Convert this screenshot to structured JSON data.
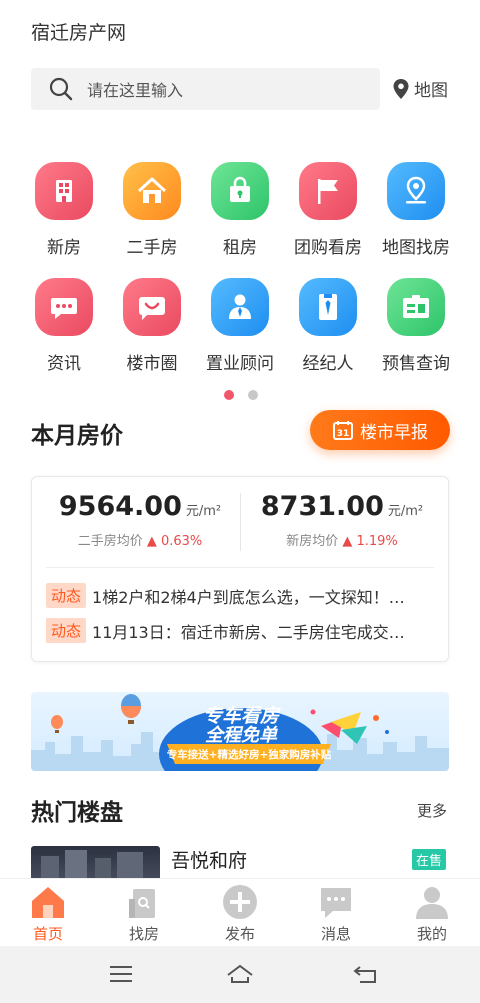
{
  "app": {
    "title": "宿迁房产网"
  },
  "search": {
    "placeholder": "请在这里输入",
    "map_label": "地图"
  },
  "quick_grid": [
    {
      "label": "新房",
      "icon": "building-icon",
      "color": "#f0576b"
    },
    {
      "label": "二手房",
      "icon": "house-icon",
      "color": "#ff9b2e"
    },
    {
      "label": "租房",
      "icon": "bag-icon",
      "color": "#3fcf78"
    },
    {
      "label": "团购看房",
      "icon": "flag-icon",
      "color": "#f0576b"
    },
    {
      "label": "地图找房",
      "icon": "location-icon",
      "color": "#2b9df5"
    },
    {
      "label": "资讯",
      "icon": "chat-icon",
      "color": "#f0576b"
    },
    {
      "label": "楼市圈",
      "icon": "smile-icon",
      "color": "#f0576b"
    },
    {
      "label": "置业顾问",
      "icon": "consultant-icon",
      "color": "#2b9df5"
    },
    {
      "label": "经纪人",
      "icon": "agent-icon",
      "color": "#2b9df5"
    },
    {
      "label": "预售查询",
      "icon": "id-card-icon",
      "color": "#3fcf78"
    }
  ],
  "pager": {
    "active_color": "#f0576b",
    "inactive_color": "#c8c8c8"
  },
  "monthly_price": {
    "title": "本月房价",
    "report_button": "楼市早报",
    "second_hand": {
      "value": "9564.00",
      "unit": "元/m²",
      "label": "二手房均价",
      "change": "0.63%"
    },
    "new_house": {
      "value": "8731.00",
      "unit": "元/m²",
      "label": "新房均价",
      "change": "1.19%"
    },
    "news": [
      {
        "tag": "动态",
        "text": "1梯2户和2梯4户到底怎么选，一文探知！…"
      },
      {
        "tag": "动态",
        "text": "11月13日：宿迁市新房、二手房住宅成交…"
      }
    ]
  },
  "banner": {
    "headline_1": "专车看房",
    "headline_2": "全程免单",
    "ribbon": "专车接送+精选好房+独家购房补贴"
  },
  "hot": {
    "title": "热门楼盘",
    "more": "更多",
    "listing": {
      "name": "吾悦和府",
      "status": "在售"
    }
  },
  "tabbar": [
    {
      "label": "首页",
      "icon": "home-icon",
      "active": true
    },
    {
      "label": "找房",
      "icon": "find-house-icon",
      "active": false
    },
    {
      "label": "发布",
      "icon": "plus-icon",
      "active": false
    },
    {
      "label": "消息",
      "icon": "message-icon",
      "active": false
    },
    {
      "label": "我的",
      "icon": "user-icon",
      "active": false
    }
  ],
  "colors": {
    "accent": "#ff5a20",
    "up": "#e84a4a",
    "tag_bg": "#ffd8c8",
    "status_badge": "#27c8a6"
  }
}
